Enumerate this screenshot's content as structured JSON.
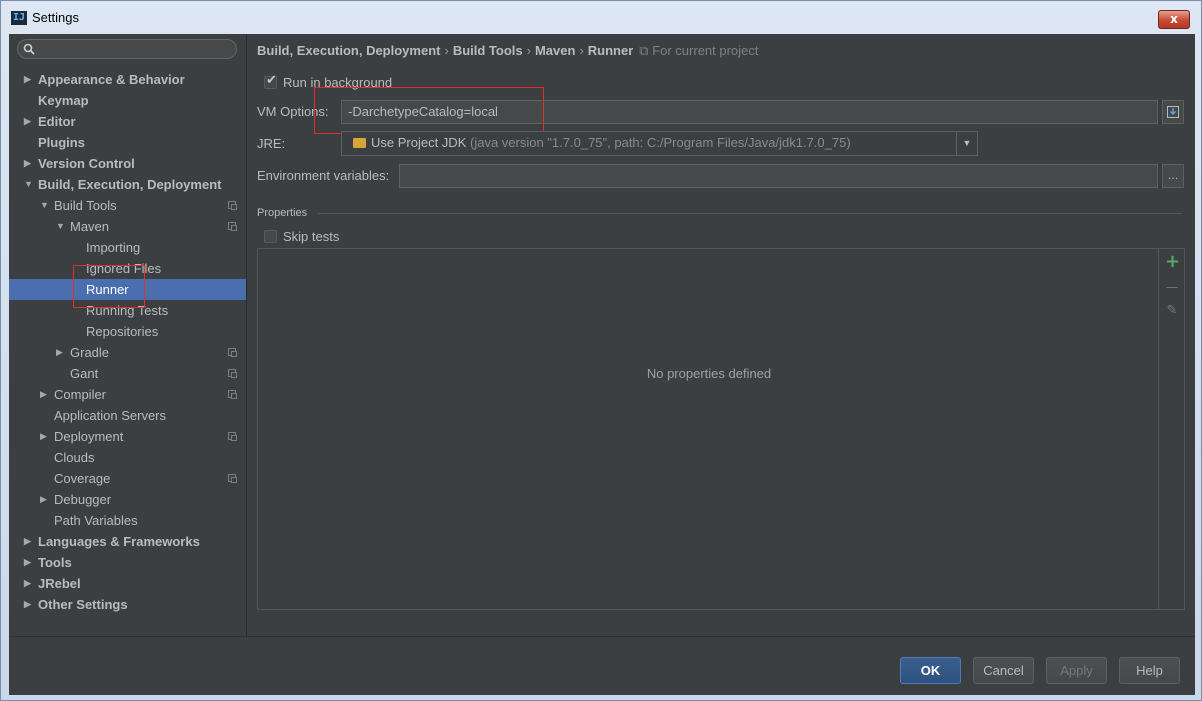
{
  "window": {
    "title": "Settings",
    "icon": "intellij-idea-icon",
    "close_label": "x"
  },
  "search": {
    "placeholder": ""
  },
  "sidebar": {
    "items": [
      {
        "label": "Appearance & Behavior",
        "arrow": "▶"
      },
      {
        "label": "Keymap"
      },
      {
        "label": "Editor",
        "arrow": "▶"
      },
      {
        "label": "Plugins"
      },
      {
        "label": "Version Control",
        "arrow": "▶"
      },
      {
        "label": "Build, Execution, Deployment",
        "arrow": "▼"
      },
      {
        "label": "Build Tools",
        "arrow": "▼"
      },
      {
        "label": "Maven",
        "arrow": "▼"
      },
      {
        "label": "Importing"
      },
      {
        "label": "Ignored Files"
      },
      {
        "label": "Runner"
      },
      {
        "label": "Running Tests"
      },
      {
        "label": "Repositories"
      },
      {
        "label": "Gradle",
        "arrow": "▶"
      },
      {
        "label": "Gant"
      },
      {
        "label": "Compiler",
        "arrow": "▶"
      },
      {
        "label": "Application Servers"
      },
      {
        "label": "Deployment",
        "arrow": "▶"
      },
      {
        "label": "Clouds"
      },
      {
        "label": "Coverage"
      },
      {
        "label": "Debugger",
        "arrow": "▶"
      },
      {
        "label": "Path Variables"
      },
      {
        "label": "Languages & Frameworks",
        "arrow": "▶"
      },
      {
        "label": "Tools",
        "arrow": "▶"
      },
      {
        "label": "JRebel",
        "arrow": "▶"
      },
      {
        "label": "Other Settings",
        "arrow": "▶"
      }
    ]
  },
  "breadcrumb": {
    "parts": [
      "Build, Execution, Deployment",
      "Build Tools",
      "Maven",
      "Runner"
    ],
    "separator": "›",
    "scope": "For current project"
  },
  "runner": {
    "run_in_background": {
      "label": "Run in background",
      "checked": true,
      "check_glyph": "✔"
    },
    "vm_options": {
      "label": "VM Options:",
      "value": "-DarchetypeCatalog=local"
    },
    "jre": {
      "label": "JRE:",
      "value": "Use Project JDK",
      "detail": "(java version \"1.7.0_75\", path: C:/Program Files/Java/jdk1.7.0_75)",
      "arrow": "▼"
    },
    "env_vars": {
      "label": "Environment variables:",
      "value": "",
      "browse": "..."
    },
    "properties_title": "Properties",
    "skip_tests": {
      "label": "Skip tests",
      "checked": false
    },
    "empty_text": "No properties defined",
    "toolbar": {
      "add": "+",
      "remove": "—",
      "edit": "✎"
    }
  },
  "footer": {
    "ok": "OK",
    "cancel": "Cancel",
    "apply": "Apply",
    "help": "Help"
  },
  "colors": {
    "accent": "#4b6eaf",
    "background": "#3c3f41",
    "highlight": "#e0302c",
    "add": "#59a869"
  }
}
